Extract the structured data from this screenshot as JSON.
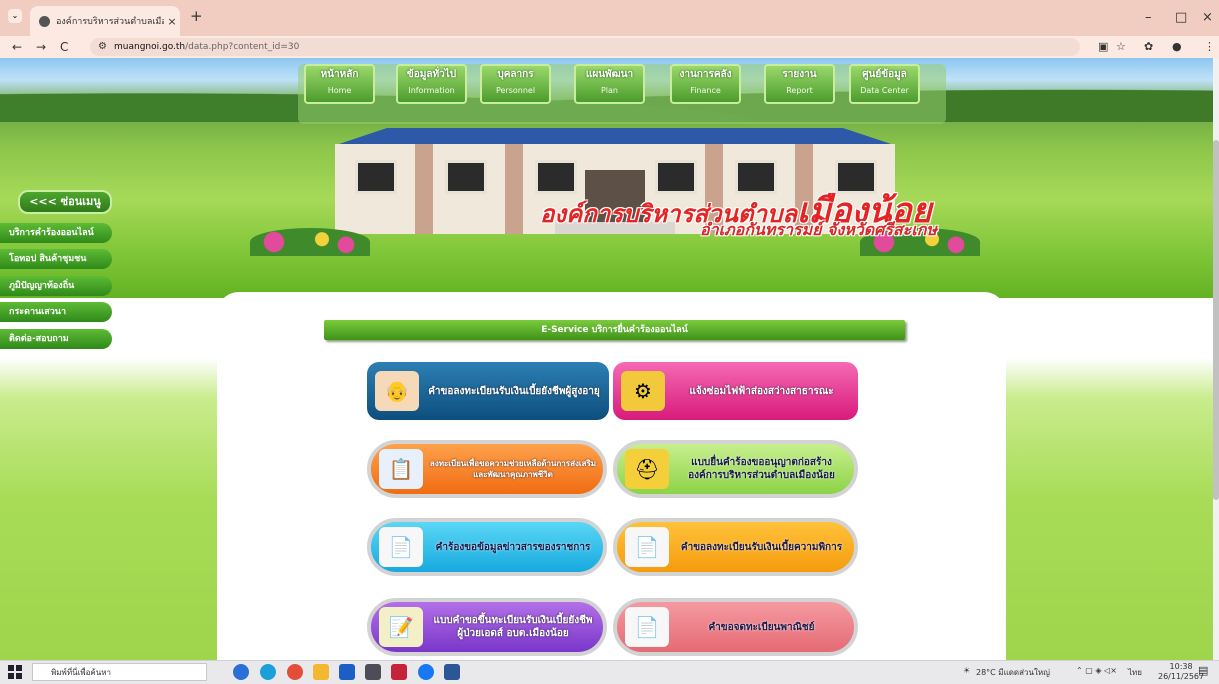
{
  "browser": {
    "tab_title": "องค์การบริหารส่วนตำบลเมืองน้อย อำ",
    "tab_close": "×",
    "new_tab": "+",
    "tablist": "⌄",
    "back": "←",
    "forward": "→",
    "reload": "C",
    "url_domain": "muangnoi.go.th",
    "url_path": "/data.php?content_id=30",
    "minimize": "–",
    "maximize": "□",
    "close": "×"
  },
  "nav": [
    {
      "th": "หน้าหลัก",
      "en": "Home"
    },
    {
      "th": "ข้อมูลทั่วไป",
      "en": "Information"
    },
    {
      "th": "บุคลากร",
      "en": "Personnel"
    },
    {
      "th": "แผนพัฒนา",
      "en": "Plan"
    },
    {
      "th": "งานการคลัง",
      "en": "Finance"
    },
    {
      "th": "รายงาน",
      "en": "Report"
    },
    {
      "th": "ศูนย์ข้อมูล",
      "en": "Data Center"
    }
  ],
  "header": {
    "title_prefix": "องค์การบริหารส่วนตำบล",
    "title_name": "เมืองน้อย",
    "subtitle": "อำเภอกันทรารมย์ จังหวัดศรีสะเกษ"
  },
  "sidebar": {
    "toggle": "<<< ซ่อนเมนู",
    "items": [
      "บริการคำร้องออนไลน์",
      "โอทอป สินค้าชุมชน",
      "ภูมิปัญญาท้องถิ่น",
      "กระดานเสวนา",
      "ติดต่อ-สอบถาม"
    ]
  },
  "eservice": {
    "heading": "E-Service บริการยื่นคำร้องออนไลน์",
    "services": [
      {
        "label": "คำขอลงทะเบียนรับเงินเบี้ยยังชีพผู้สูงอายุ"
      },
      {
        "label": "แจ้งซ่อมไฟฟ้าส่องสว่างสาธารณะ"
      },
      {
        "label": "ลงทะเบียนเพื่อขอความช่วยเหลือด้านการส่งเสริมและพัฒนาคุณภาพชีวิต"
      },
      {
        "label": "แบบยื่นคำร้องขออนุญาตก่อสร้าง องค์การบริหารส่วนตำบลเมืองน้อย"
      },
      {
        "label": "คำร้องขอข้อมูลข่าวสารของราชการ"
      },
      {
        "label": "คำขอลงทะเบียนรับเงินเบี้ยความพิการ"
      },
      {
        "label": "แบบคำขอขึ้นทะเบียนรับเงินเบี้ยยังชีพ ผู้ป่วยเอดส์ อบต.เมืองน้อย"
      },
      {
        "label": "คำขอจดทะเบียนพาณิชย์"
      }
    ]
  },
  "taskbar": {
    "search_placeholder": "พิมพ์ที่นี่เพื่อค้นหา",
    "weather": "28°C มีแดดส่วนใหญ่",
    "lang": "ไทย",
    "time": "10:38",
    "date": "26/11/2567"
  },
  "colors": {
    "tab_bar": "#f0cdc0",
    "nav_green": "#4c9c2d",
    "title_red": "#e32424"
  }
}
